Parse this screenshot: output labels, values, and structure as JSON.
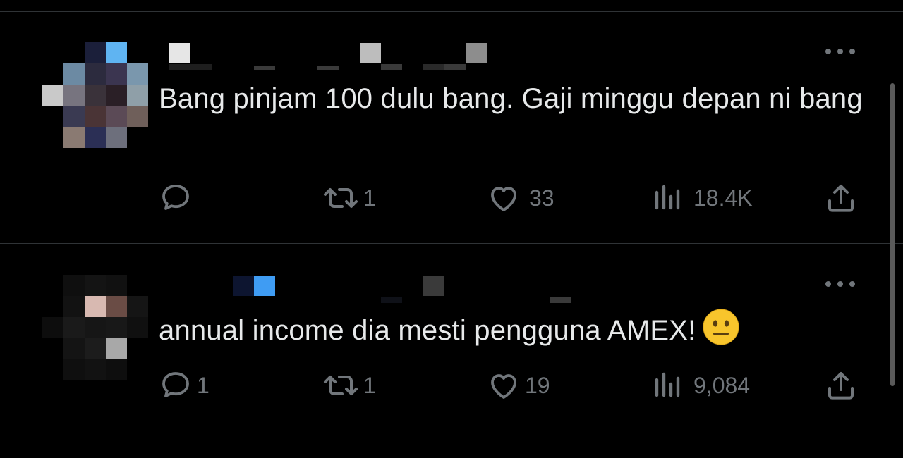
{
  "tweets": [
    {
      "text": "Bang pinjam 100 dulu bang. Gaji minggu depan ni bang",
      "actions": {
        "reply_count": "",
        "retweet_count": "1",
        "like_count": "33",
        "view_count": "18.4K"
      }
    },
    {
      "text": "annual income dia mesti pengguna AMEX!",
      "emoji": "neutral-face-emoji",
      "actions": {
        "reply_count": "1",
        "retweet_count": "1",
        "like_count": "19",
        "view_count": "9,084"
      }
    }
  ],
  "colors": {
    "background": "#000000",
    "text": "#e7e9ea",
    "muted": "#71767b",
    "divider": "#2f3336"
  }
}
